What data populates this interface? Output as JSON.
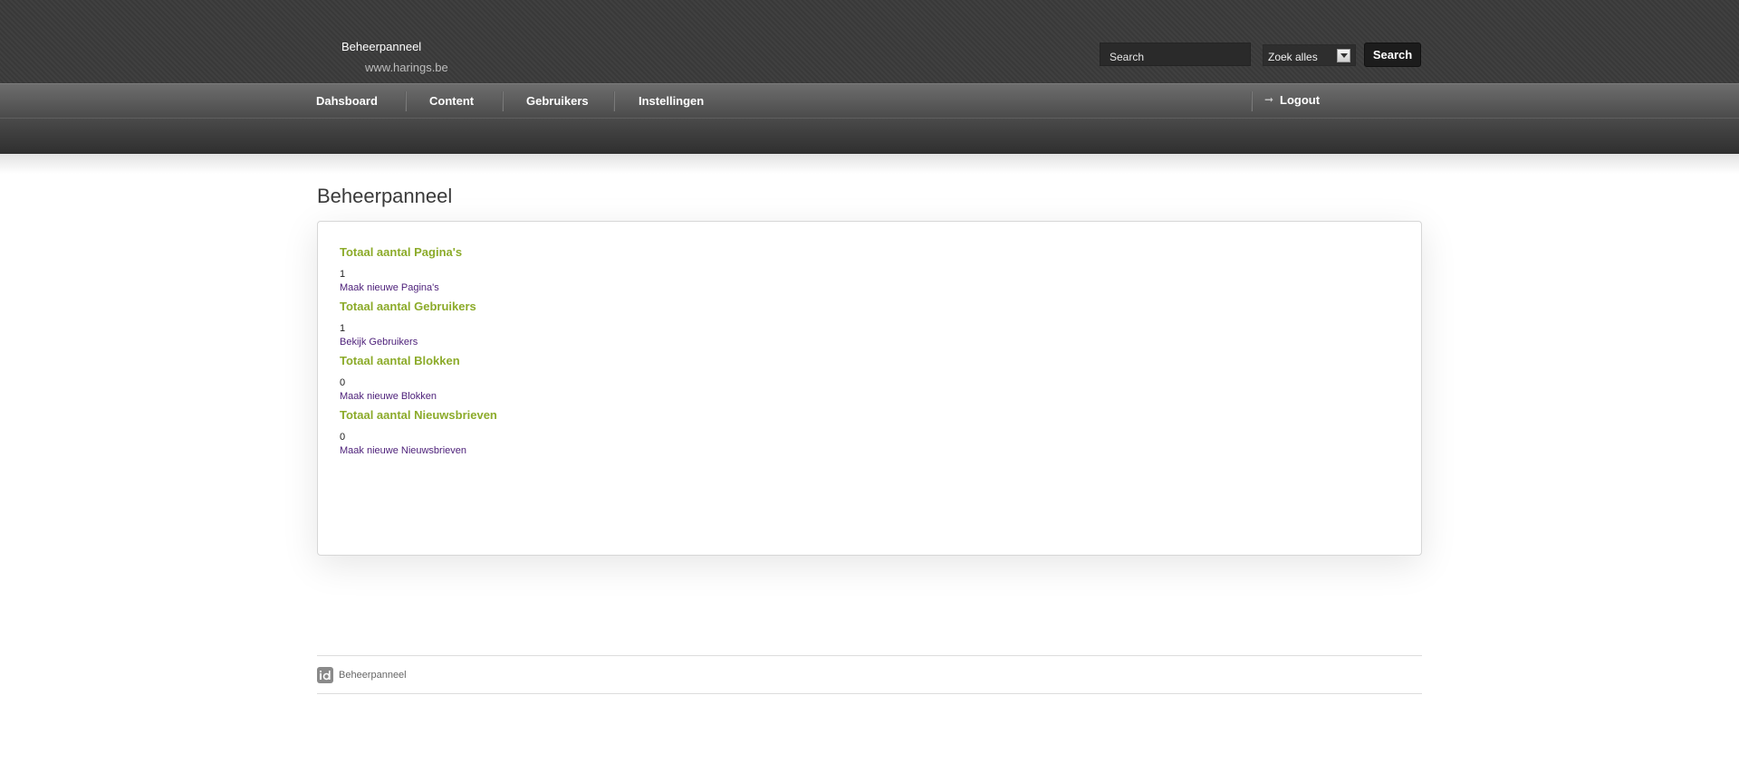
{
  "header": {
    "brand_title": "Beheerpanneel",
    "brand_subtitle": "www.harings.be",
    "search": {
      "value": "Search",
      "scope_selected": "Zoek alles",
      "button_label": "Search"
    }
  },
  "nav": {
    "items": [
      {
        "label": "Dahsboard"
      },
      {
        "label": "Content"
      },
      {
        "label": "Gebruikers"
      },
      {
        "label": "Instellingen"
      }
    ],
    "logout_label": "Logout"
  },
  "main": {
    "title": "Beheerpanneel",
    "stats": [
      {
        "title": "Totaal aantal Pagina's",
        "value": "1",
        "link": "Maak nieuwe Pagina's"
      },
      {
        "title": "Totaal aantal Gebruikers",
        "value": "1",
        "link": "Bekijk Gebruikers"
      },
      {
        "title": "Totaal aantal Blokken",
        "value": "0",
        "link": "Maak nieuwe Blokken"
      },
      {
        "title": "Totaal aantal Nieuwsbrieven",
        "value": "0",
        "link": "Maak nieuwe Nieuwsbrieven"
      }
    ]
  },
  "footer": {
    "text": "Beheerpanneel",
    "logo_icon": "id-logo-icon"
  },
  "colors": {
    "accent_green": "#8cab2a",
    "link_purple": "#4b1e78",
    "header_dark": "#3b3b3b"
  }
}
